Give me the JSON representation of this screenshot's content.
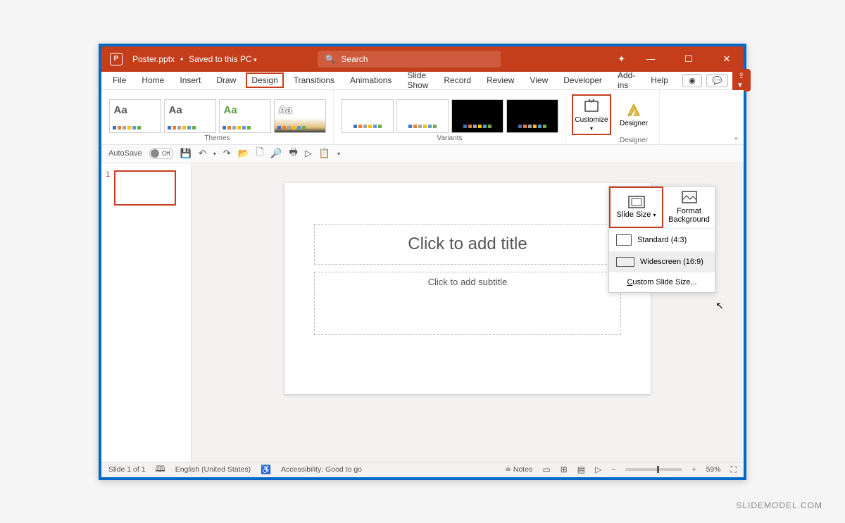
{
  "titlebar": {
    "filename": "Poster.pptx",
    "saved_to": "Saved to this PC",
    "search_placeholder": "Search"
  },
  "menubar": {
    "tabs": [
      "File",
      "Home",
      "Insert",
      "Draw",
      "Design",
      "Transitions",
      "Animations",
      "Slide Show",
      "Record",
      "Review",
      "View",
      "Developer",
      "Add-ins",
      "Help"
    ],
    "active": "Design"
  },
  "ribbon": {
    "themes_label": "Themes",
    "variants_label": "Variants",
    "customize_label": "Customize",
    "designer_label": "Designer",
    "designer_group_label": "Designer"
  },
  "customize_panel": {
    "slide_size": "Slide Size",
    "format_bg": "Format Background",
    "standard": "Standard (4:3)",
    "widescreen": "Widescreen (16:9)",
    "custom": "Custom Slide Size..."
  },
  "qat": {
    "autosave": "AutoSave",
    "off": "Off"
  },
  "thumb": {
    "num": "1"
  },
  "slide": {
    "title_placeholder": "Click to add title",
    "subtitle_placeholder": "Click to add subtitle"
  },
  "statusbar": {
    "slide_of": "Slide 1 of 1",
    "language": "English (United States)",
    "accessibility": "Accessibility: Good to go",
    "notes": "Notes",
    "zoom": "59%"
  },
  "watermark": "SLIDEMODEL.COM"
}
